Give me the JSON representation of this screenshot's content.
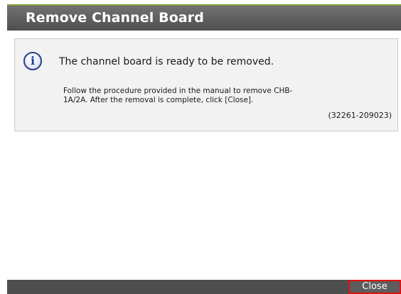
{
  "dialog": {
    "title": "Remove Channel Board",
    "icon": "info-icon",
    "icon_glyph": "i",
    "message": "The channel board is ready to be removed.",
    "detail": "Follow the procedure provided in the manual to remove CHB-\n1A/2A. After the removal is complete, click [Close].",
    "code": "(32261-209023)"
  },
  "footer": {
    "close_label": "Close"
  },
  "colors": {
    "titlebar": "#5f5f5f",
    "titlebar_accent": "#7fa23c",
    "footer": "#4e4e4e",
    "close_highlight": "#e01010"
  }
}
